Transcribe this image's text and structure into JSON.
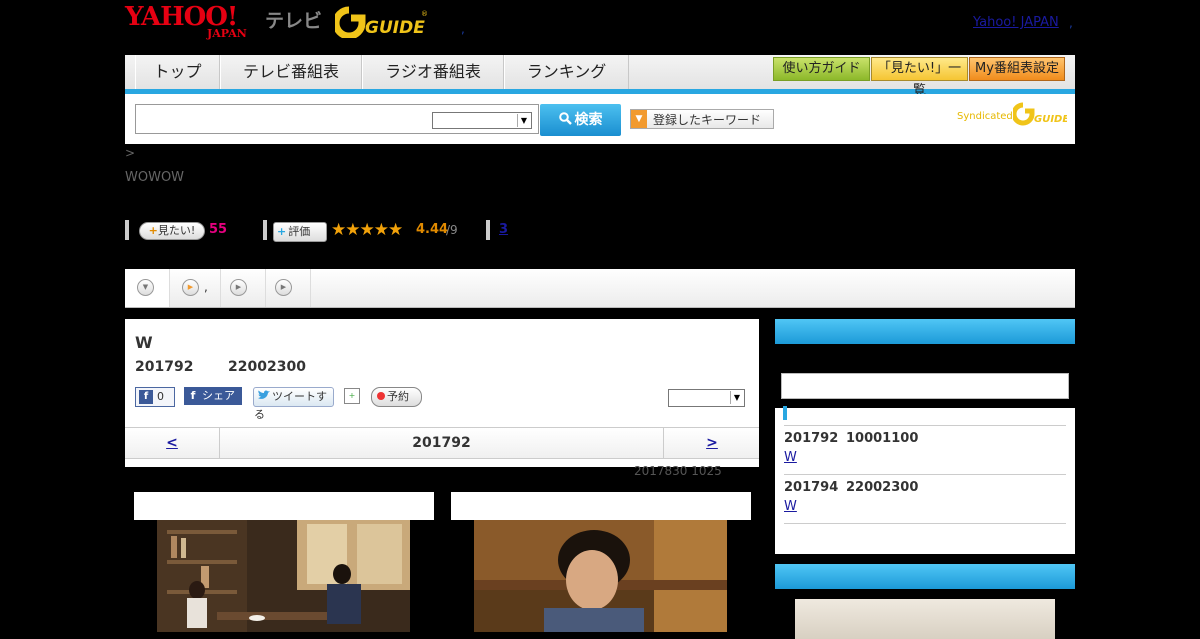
{
  "header": {
    "logo_yahoo": "YAHOO!",
    "logo_japan": "JAPAN",
    "logo_tv": "テレビ",
    "logo_gguide": "G-GUIDE",
    "dot": ",",
    "yahoo_japan_link": "Yahoo! JAPAN",
    "dot2": ","
  },
  "nav": {
    "items": [
      "トップ",
      "テレビ番組表",
      "ラジオ番組表",
      "ランキング"
    ],
    "buttons": [
      "使い方ガイド",
      "「見たい!」一覧",
      "My番組表設定"
    ]
  },
  "search": {
    "input_value": "",
    "select_value": "",
    "button_label": "検索",
    "keyword_button_label": "登録したキーワード",
    "syndicated_label": "Syndicated",
    "syndicated_logo": "G-GUIDE"
  },
  "breadcrumb": ">",
  "channel": "WOWOW",
  "stats": {
    "mitai_label": "見たい!",
    "mitai_count": "55",
    "hyoka_label": "評価",
    "stars": "★★★★★",
    "rating": "4.44",
    "rating_of": "/9",
    "review_count": "3"
  },
  "tabs": [
    {
      "label": ""
    },
    {
      "label": ","
    },
    {
      "label": ""
    },
    {
      "label": ""
    }
  ],
  "program": {
    "title": "W",
    "date": "201792",
    "time": "22002300",
    "fb_like_count": "0",
    "fb_share_label": "シェア",
    "tweet_label": "ツイートする",
    "reserve_label": "予約",
    "select_value": ""
  },
  "pager": {
    "prev": "<",
    "current": "201792",
    "next": ">"
  },
  "updated": "2017830  1025",
  "sidebar": {
    "header": "",
    "input_value": "",
    "items": [
      {
        "date": "201792",
        "time": "10001100",
        "link": "W"
      },
      {
        "date": "201794",
        "time": "22002300",
        "link": "W"
      }
    ]
  },
  "sidebar2": {
    "header": ""
  },
  "colors": {
    "accent_blue": "#29a7e1",
    "brand_red": "#e60012",
    "mitai_pink": "#e4007f",
    "star_orange": "#f2a20a",
    "link_blue": "#1a1aa0"
  },
  "icons": {
    "search": "search-icon",
    "facebook": "facebook-icon",
    "twitter": "twitter-icon",
    "calendar": "calendar-icon",
    "record": "record-dot-icon",
    "play": "play-icon"
  }
}
